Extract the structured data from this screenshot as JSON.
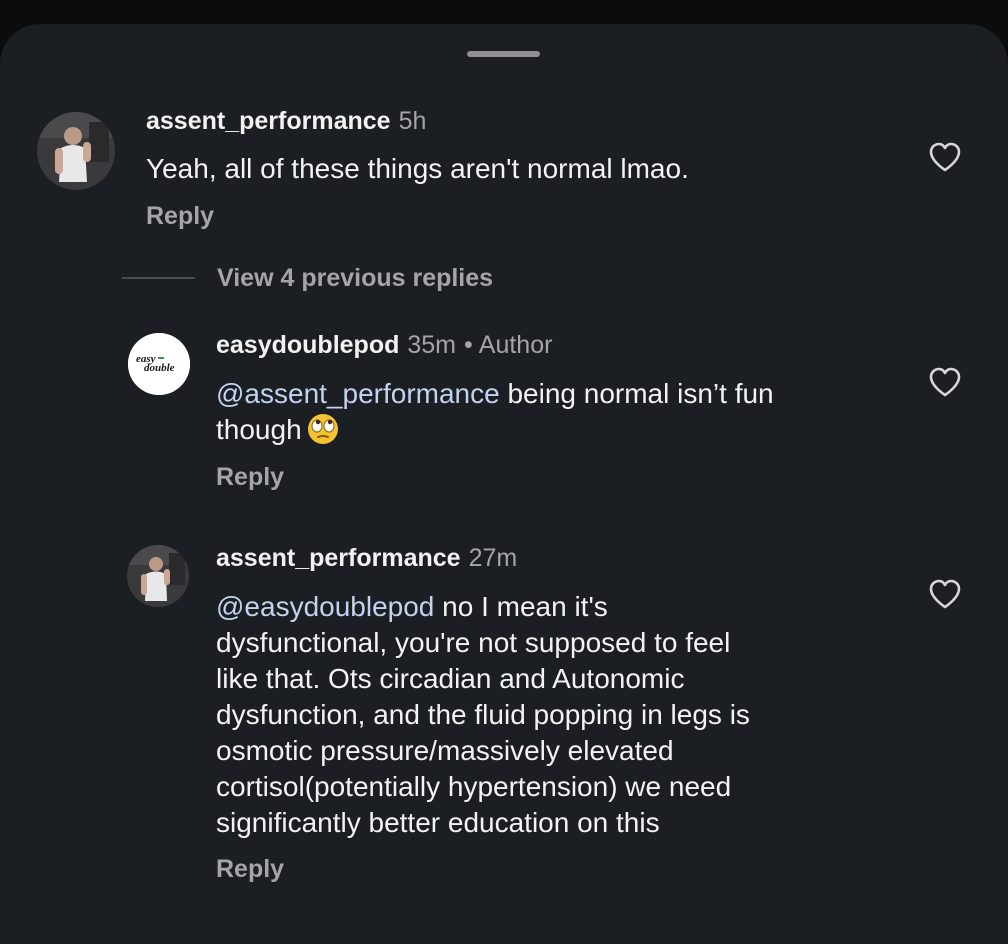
{
  "comments": [
    {
      "username": "assent_performance",
      "time": "5h",
      "text": "Yeah, all of these things aren't normal lmao.",
      "reply_label": "Reply"
    },
    {
      "username": "easydoublepod",
      "time": "35m",
      "dot": "•",
      "badge": "Author",
      "mention": "@assent_performance",
      "text_line1": " being normal isn’t fun",
      "text_line2": "though",
      "emoji": "eye-roll-emoji",
      "reply_label": "Reply",
      "avatar_logo_top": "easy",
      "avatar_logo_bottom": "double"
    },
    {
      "username": "assent_performance",
      "time": "27m",
      "mention": "@easydoublepod",
      "lines": [
        " no I mean it's",
        "dysfunctional, you're not supposed to feel",
        "like that. Ots circadian and Autonomic",
        "dysfunction, and the fluid popping in legs is",
        "osmotic pressure/massively elevated",
        "cortisol(potentially hypertension) we need",
        "significantly better education on this"
      ],
      "reply_label": "Reply"
    }
  ],
  "view_replies_label": "View 4 previous replies",
  "icons": {
    "like": "heart-icon",
    "drag": "drag-handle"
  },
  "colors": {
    "background": "#1b1e22",
    "mention": "#c3d2ee",
    "muted": "#a3a5a9"
  }
}
